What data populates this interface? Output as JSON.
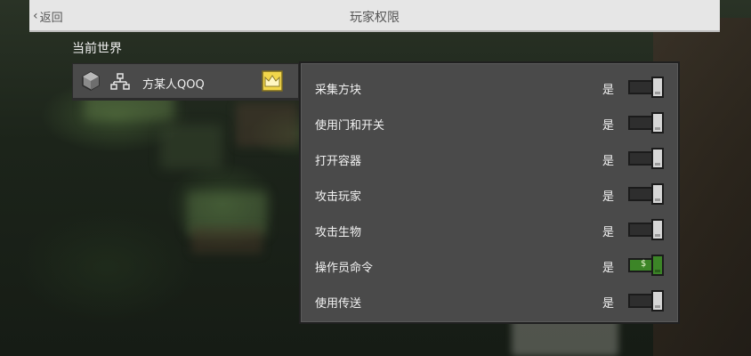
{
  "header": {
    "back_label": "返回",
    "title": "玩家权限"
  },
  "world": {
    "section_label": "当前世界",
    "player": {
      "name": "方某人QOQ",
      "role_icon": "crown-icon"
    }
  },
  "permissions": [
    {
      "label": "采集方块",
      "value": "是",
      "toggle": "on"
    },
    {
      "label": "使用门和开关",
      "value": "是",
      "toggle": "on"
    },
    {
      "label": "打开容器",
      "value": "是",
      "toggle": "on"
    },
    {
      "label": "攻击玩家",
      "value": "是",
      "toggle": "on"
    },
    {
      "label": "攻击生物",
      "value": "是",
      "toggle": "on"
    },
    {
      "label": "操作员命令",
      "value": "是",
      "toggle": "on-green"
    },
    {
      "label": "使用传送",
      "value": "是",
      "toggle": "on"
    }
  ],
  "colors": {
    "header_bg": "#e6e6e6",
    "panel_bg": "#4a4a4a",
    "toggle_green": "#3c8527",
    "crown": "#f2d64b"
  }
}
